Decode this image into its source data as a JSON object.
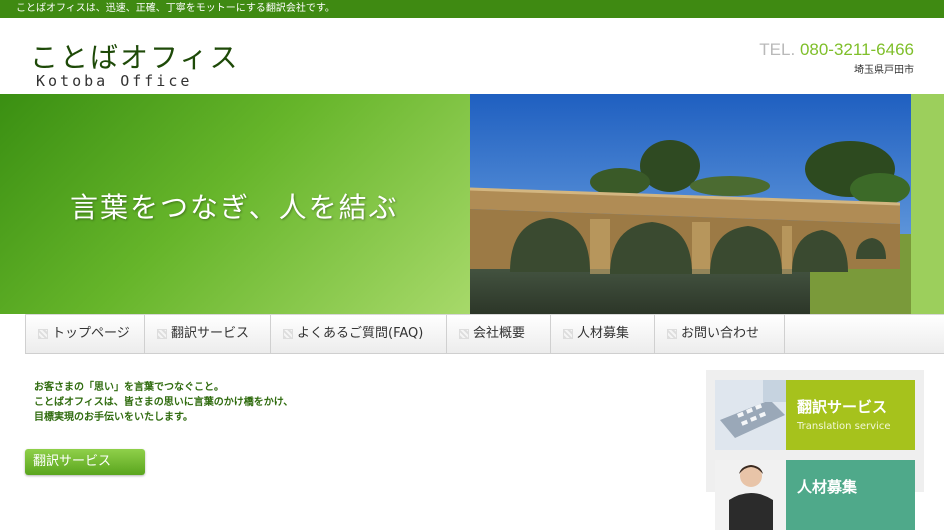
{
  "topbar": {
    "text": "ことばオフィスは、迅速、正確、丁寧をモットーにする翻訳会社です。"
  },
  "header": {
    "logo_jp": "ことばオフィス",
    "logo_en": "Kotoba Office",
    "tel_prefix": "TEL.",
    "tel_number": "080-3211-6466",
    "address": "埼玉県戸田市"
  },
  "hero": {
    "tagline": "言葉をつなぎ、人を結ぶ"
  },
  "nav": {
    "items": [
      {
        "label": "トップページ"
      },
      {
        "label": "翻訳サービス"
      },
      {
        "label": "よくあるご質問(FAQ)"
      },
      {
        "label": "会社概要"
      },
      {
        "label": "人材募集"
      },
      {
        "label": "お問い合わせ"
      }
    ]
  },
  "intro": {
    "line1": "お客さまの「思い」を言葉でつなぐこと。",
    "line2": "ことばオフィスは、皆さまの思いに言葉のかけ橋をかけ、",
    "line3": "目標実現のお手伝いをいたします。"
  },
  "main": {
    "service_button": "翻訳サービス"
  },
  "sidebar": {
    "banners": [
      {
        "title": "翻訳サービス",
        "subtitle": "Translation service",
        "color": "#a6c21c"
      },
      {
        "title": "人材募集",
        "subtitle": "",
        "color": "#4fa98a"
      }
    ]
  }
}
